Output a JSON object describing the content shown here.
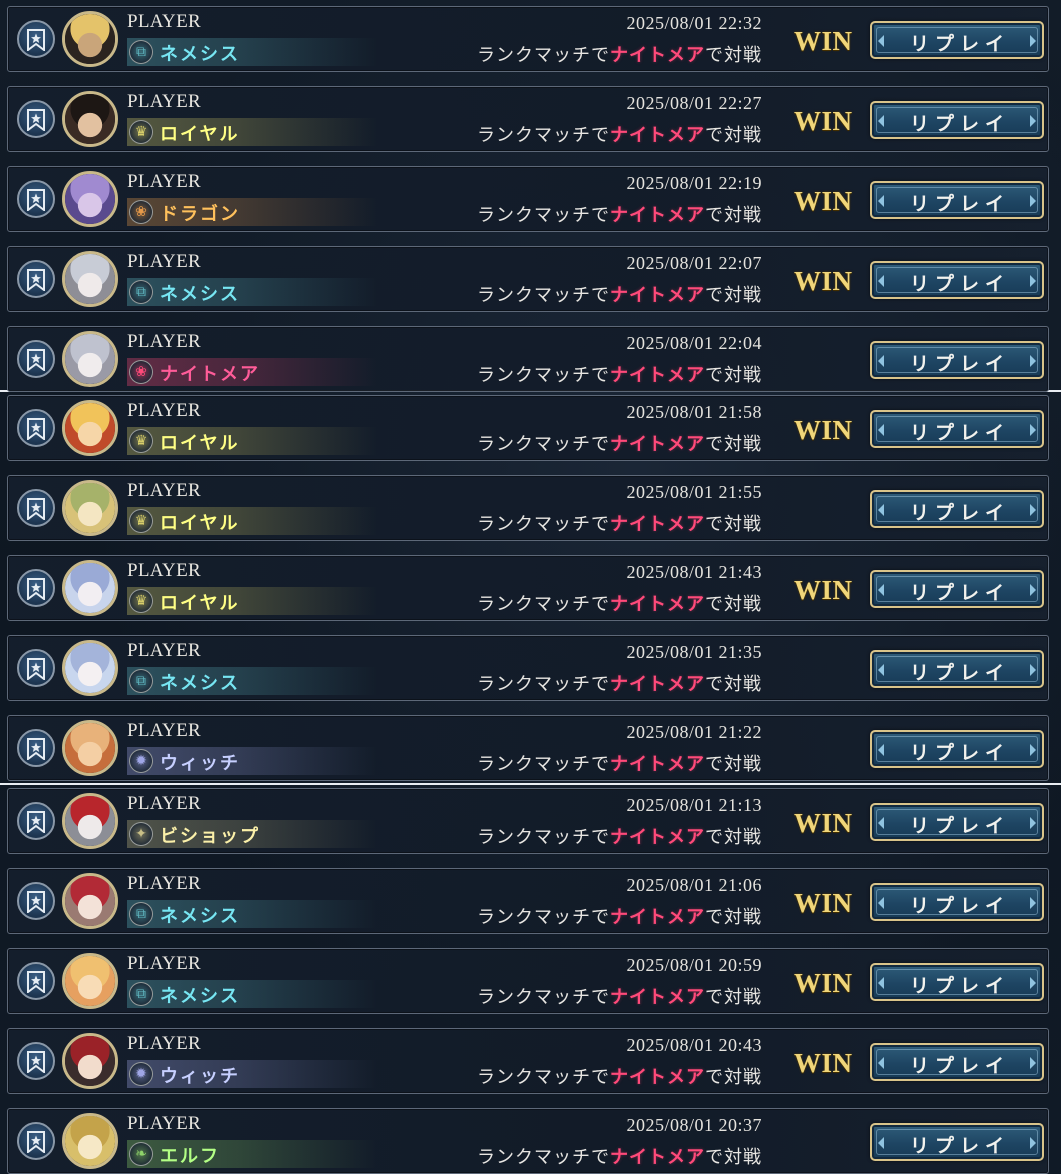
{
  "labels": {
    "player": "PLAYER",
    "match_prefix": "ランクマッチで",
    "opponent_class": "ナイトメア",
    "match_suffix": "で対戦",
    "win": "WIN",
    "replay": "リプレイ"
  },
  "colors": {
    "nemesis": "#5fb8c2",
    "royal": "#d8cf6a",
    "dragon": "#e69a4a",
    "nightmare": "#ff4a7a",
    "witch": "#9fa6e6",
    "bishop": "#c9c087",
    "elf": "#8fd36a",
    "win": "#f0d67a",
    "button_border": "#d9c48a"
  },
  "matches": [
    {
      "class": "ネメシス",
      "class_key": "nemesis",
      "class_icon": "nemesis-icon",
      "datetime": "2025/08/01 22:32",
      "win": true
    },
    {
      "class": "ロイヤル",
      "class_key": "royal",
      "class_icon": "royal-crown-icon",
      "datetime": "2025/08/01 22:27",
      "win": true
    },
    {
      "class": "ドラゴン",
      "class_key": "dragon",
      "class_icon": "dragon-icon",
      "datetime": "2025/08/01 22:19",
      "win": true
    },
    {
      "class": "ネメシス",
      "class_key": "nemesis",
      "class_icon": "nemesis-icon",
      "datetime": "2025/08/01 22:07",
      "win": true
    },
    {
      "class": "ナイトメア",
      "class_key": "nightmare",
      "class_icon": "nightmare-icon",
      "datetime": "2025/08/01 22:04",
      "win": false
    },
    {
      "class": "ロイヤル",
      "class_key": "royal",
      "class_icon": "royal-crown-icon",
      "datetime": "2025/08/01 21:58",
      "win": true
    },
    {
      "class": "ロイヤル",
      "class_key": "royal",
      "class_icon": "royal-crown-icon",
      "datetime": "2025/08/01 21:55",
      "win": false
    },
    {
      "class": "ロイヤル",
      "class_key": "royal",
      "class_icon": "royal-crown-icon",
      "datetime": "2025/08/01 21:43",
      "win": true
    },
    {
      "class": "ネメシス",
      "class_key": "nemesis",
      "class_icon": "nemesis-icon",
      "datetime": "2025/08/01 21:35",
      "win": false
    },
    {
      "class": "ウィッチ",
      "class_key": "witch",
      "class_icon": "witch-icon",
      "datetime": "2025/08/01 21:22",
      "win": false
    },
    {
      "class": "ビショップ",
      "class_key": "bishop",
      "class_icon": "bishop-icon",
      "datetime": "2025/08/01 21:13",
      "win": true
    },
    {
      "class": "ネメシス",
      "class_key": "nemesis",
      "class_icon": "nemesis-icon",
      "datetime": "2025/08/01 21:06",
      "win": true
    },
    {
      "class": "ネメシス",
      "class_key": "nemesis",
      "class_icon": "nemesis-icon",
      "datetime": "2025/08/01 20:59",
      "win": true
    },
    {
      "class": "ウィッチ",
      "class_key": "witch",
      "class_icon": "witch-icon",
      "datetime": "2025/08/01 20:43",
      "win": true
    },
    {
      "class": "エルフ",
      "class_key": "elf",
      "class_icon": "elf-leaf-icon",
      "datetime": "2025/08/01 20:37",
      "win": false
    }
  ]
}
